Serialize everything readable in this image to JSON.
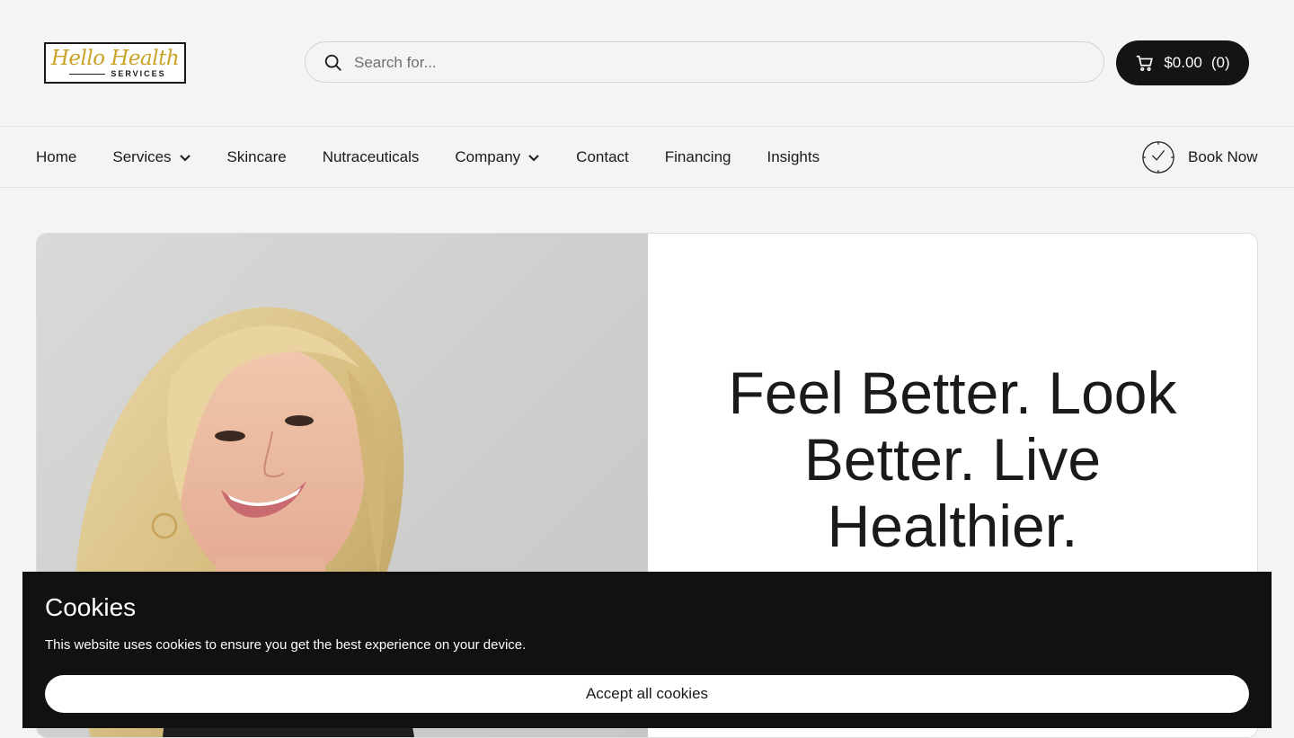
{
  "logo": {
    "script": "Hello Health",
    "subtitle": "SERVICES"
  },
  "search": {
    "placeholder": "Search for...",
    "icon": "search-icon"
  },
  "cart": {
    "total": "$0.00",
    "count": "(0)",
    "icon": "cart-icon"
  },
  "nav": {
    "items": [
      {
        "label": "Home",
        "dropdown": false
      },
      {
        "label": "Services",
        "dropdown": true
      },
      {
        "label": "Skincare",
        "dropdown": false
      },
      {
        "label": "Nutraceuticals",
        "dropdown": false
      },
      {
        "label": "Company",
        "dropdown": true
      },
      {
        "label": "Contact",
        "dropdown": false
      },
      {
        "label": "Financing",
        "dropdown": false
      },
      {
        "label": "Insights",
        "dropdown": false
      }
    ],
    "book_label": "Book Now",
    "book_icon": "clock-check-icon"
  },
  "hero": {
    "headline": "Feel Better. Look Better. Live Healthier.",
    "image": "woman-portrait-photo"
  },
  "cookies": {
    "title": "Cookies",
    "text": "This website uses cookies to ensure you get the best experience on your device.",
    "accept_label": "Accept all cookies"
  },
  "colors": {
    "background": "#f4f4f4",
    "dark": "#141414",
    "logo_gold": "#c9a227",
    "banner": "#111111"
  }
}
